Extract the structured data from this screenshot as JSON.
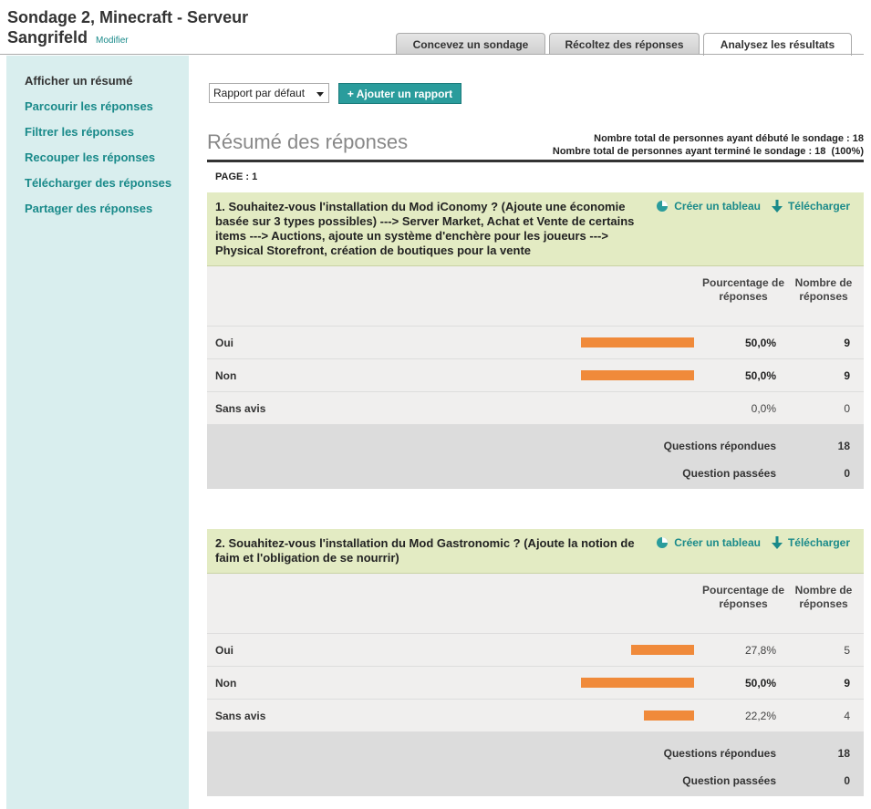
{
  "header": {
    "title": "Sondage 2, Minecraft - Serveur Sangrifeld",
    "modify_label": "Modifier"
  },
  "tabs": [
    {
      "label": "Concevez un sondage"
    },
    {
      "label": "Récoltez des réponses"
    },
    {
      "label": "Analysez les résultats",
      "active": true
    }
  ],
  "sidebar": {
    "items": [
      {
        "label": "Afficher un résumé",
        "current": true
      },
      {
        "label": "Parcourir les réponses"
      },
      {
        "label": "Filtrer les réponses"
      },
      {
        "label": "Recouper les réponses"
      },
      {
        "label": "Télécharger des réponses"
      },
      {
        "label": "Partager des réponses"
      }
    ]
  },
  "toolbar": {
    "report_select_value": "Rapport par défaut",
    "add_report_label": "+ Ajouter un rapport"
  },
  "summary": {
    "title": "Résumé des réponses",
    "started_text": "Nombre total de personnes ayant débuté le sondage : 18",
    "finished_text": "Nombre total de personnes ayant terminé le sondage : 18  (100%)",
    "page_label": "PAGE : 1"
  },
  "labels": {
    "create_chart": "Créer un tableau",
    "download": "Télécharger",
    "pct_header": "Pourcentage de réponses",
    "count_header": "Nombre de réponses",
    "answered": "Questions répondues",
    "skipped": "Question passées"
  },
  "colors": {
    "accent": "#2a9c9c",
    "bar": "#f08a3a",
    "question_bg": "#e3ebc3"
  },
  "questions": [
    {
      "text": "1. Souhaitez-vous l'installation du Mod iConomy ? (Ajoute une économie basée sur 3 types possibles) ---> Server Market, Achat et Vente de certains items ---> Auctions, ajoute un système d'enchère pour les joueurs ---> Physical Storefront, création de boutiques pour la vente",
      "rows": [
        {
          "label": "Oui",
          "percent": 50.0,
          "percent_text": "50,0%",
          "count": "9",
          "top": true
        },
        {
          "label": "Non",
          "percent": 50.0,
          "percent_text": "50,0%",
          "count": "9",
          "top": true
        },
        {
          "label": "Sans avis",
          "percent": 0.0,
          "percent_text": "0,0%",
          "count": "0",
          "top": false
        }
      ],
      "answered": "18",
      "skipped": "0"
    },
    {
      "text": "2. Souahitez-vous l'installation du Mod Gastronomic ? (Ajoute la notion de faim et l'obligation de se nourrir)",
      "rows": [
        {
          "label": "Oui",
          "percent": 27.8,
          "percent_text": "27,8%",
          "count": "5",
          "top": false
        },
        {
          "label": "Non",
          "percent": 50.0,
          "percent_text": "50,0%",
          "count": "9",
          "top": true
        },
        {
          "label": "Sans avis",
          "percent": 22.2,
          "percent_text": "22,2%",
          "count": "4",
          "top": false
        }
      ],
      "answered": "18",
      "skipped": "0"
    }
  ]
}
